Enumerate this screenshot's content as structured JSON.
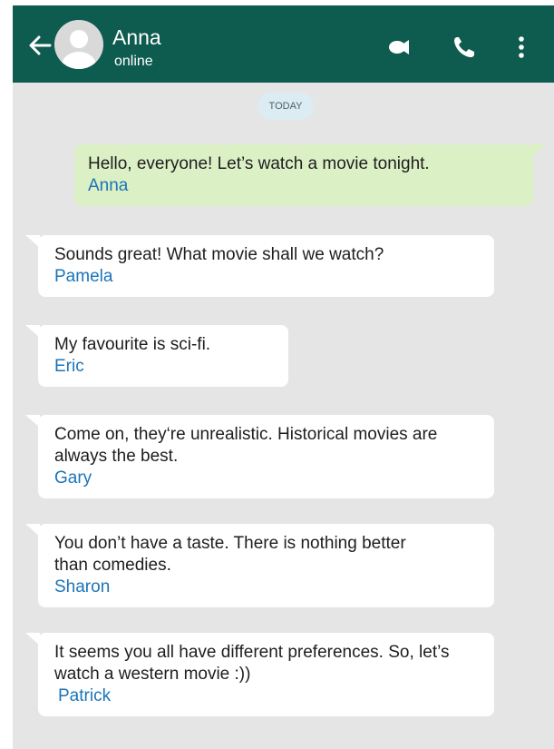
{
  "header": {
    "contact_name": "Anna",
    "contact_status": "online",
    "bg_color": "#0d5c4f"
  },
  "date_chip": "TODAY",
  "messages": [
    {
      "direction": "outgoing",
      "text": "Hello, everyone! Let’s watch a movie tonight.",
      "sender": "Anna"
    },
    {
      "direction": "incoming",
      "text": "Sounds great! What movie shall we watch?",
      "sender": "Pamela"
    },
    {
      "direction": "incoming",
      "text": "My favourite is sci-fi.",
      "sender": "Eric"
    },
    {
      "direction": "incoming",
      "text": "Come on, they‘re unrealistic. Historical movies are always the best.",
      "sender": "Gary"
    },
    {
      "direction": "incoming",
      "text": "You don’t have a taste. There is nothing better than comedies.",
      "sender": "Sharon"
    },
    {
      "direction": "incoming",
      "text": "It seems you all have different preferences. So, let’s watch a western movie :))",
      "sender": "Patrick"
    }
  ],
  "icons": {
    "back": "arrow-left-icon",
    "video": "video-camera-icon",
    "call": "phone-icon",
    "menu": "more-vertical-icon"
  },
  "colors": {
    "outgoing_bubble": "#dcf0c6",
    "incoming_bubble": "#ffffff",
    "sender_name": "#1b74b8",
    "chat_background": "#e5e5e5"
  }
}
